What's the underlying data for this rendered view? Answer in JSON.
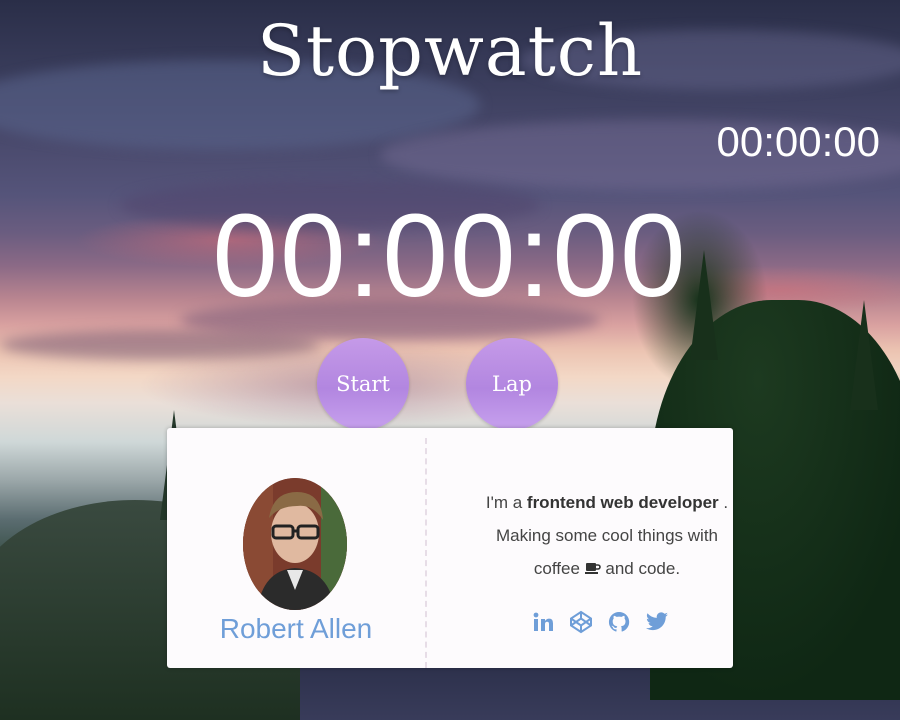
{
  "title": "Stopwatch",
  "lap_time": "00:00:00",
  "main_time": "00:00:00",
  "buttons": {
    "start_label": "Start",
    "lap_label": "Lap"
  },
  "profile": {
    "name": "Robert Allen",
    "bio_prefix": "I'm a ",
    "bio_bold": "frontend web developer",
    "bio_after_bold": " .",
    "bio_line2": "Making some cool things with",
    "bio_line3_start": "coffee ",
    "bio_line3_end": " and code.",
    "coffee_icon": "coffee-icon",
    "socials": [
      "linkedin-icon",
      "codepen-icon",
      "github-icon",
      "twitter-icon"
    ]
  },
  "colors": {
    "accent": "#6f9ed8",
    "button": "#b286e0",
    "text_light": "#ffffff"
  }
}
